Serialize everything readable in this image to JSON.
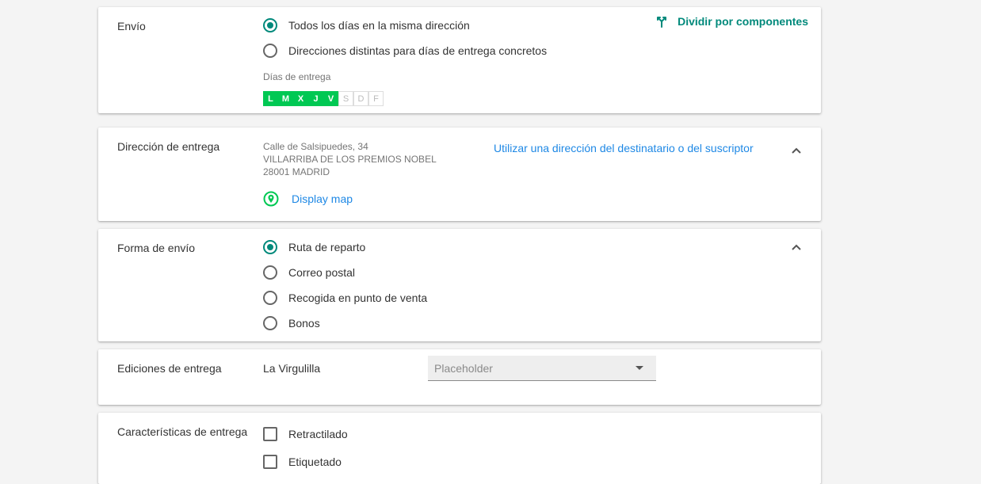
{
  "shipping": {
    "label": "Envío",
    "options": [
      "Todos los días en la misma dirección",
      "Direcciones distintas para días de entrega concretos"
    ],
    "selected_index": 0,
    "split_label": "Dividir por componentes",
    "days_label": "Días de entrega",
    "days": [
      {
        "letter": "L",
        "active": true
      },
      {
        "letter": "M",
        "active": true
      },
      {
        "letter": "X",
        "active": true
      },
      {
        "letter": "J",
        "active": true
      },
      {
        "letter": "V",
        "active": true
      },
      {
        "letter": "S",
        "active": false
      },
      {
        "letter": "D",
        "active": false
      },
      {
        "letter": "F",
        "active": false
      }
    ]
  },
  "address": {
    "label": "Dirección de entrega",
    "lines": [
      "Calle de Salsipuedes, 34",
      "VILLARRIBA DE LOS PREMIOS NOBEL",
      "28001 MADRID"
    ],
    "use_recipient_link": "Utilizar una dirección del destinatario o del suscriptor",
    "map_link": "Display map"
  },
  "shipping_method": {
    "label": "Forma de envío",
    "options": [
      "Ruta de reparto",
      "Correo postal",
      "Recogida en punto de venta",
      "Bonos"
    ],
    "selected_index": 0
  },
  "editions": {
    "label": "Ediciones de entrega",
    "value": "La Virgulilla",
    "select_placeholder": "Placeholder"
  },
  "features": {
    "label": "Características de entrega",
    "options": [
      "Retractilado",
      "Etiquetado"
    ]
  },
  "colors": {
    "teal": "#00897b",
    "green": "#00c853",
    "link_blue": "#1e88e5"
  }
}
